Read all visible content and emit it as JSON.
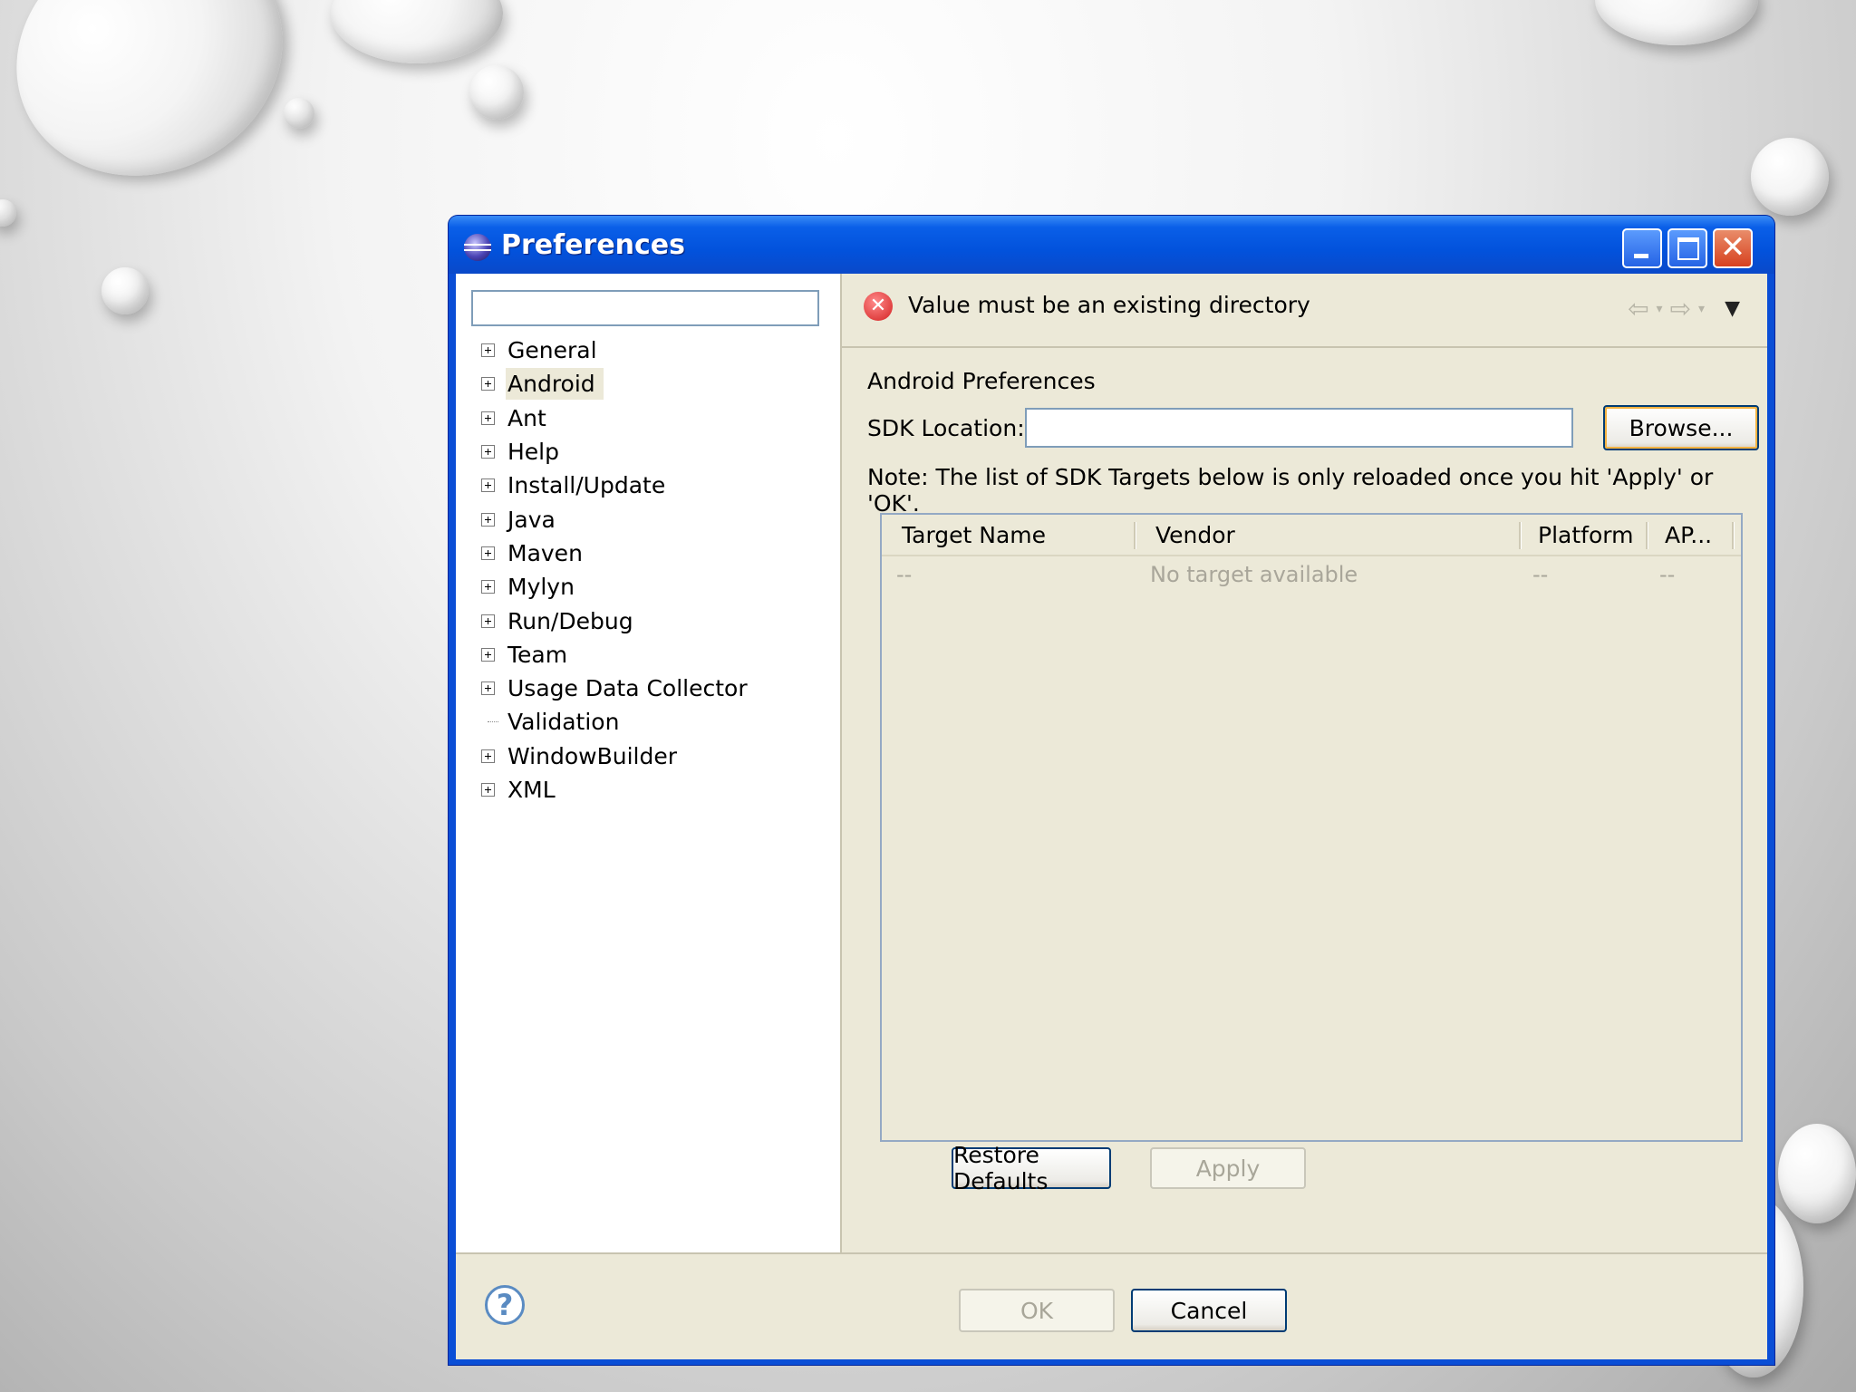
{
  "window": {
    "title": "Preferences"
  },
  "left_pane": {
    "filter_placeholder": "",
    "tree": [
      {
        "label": "General",
        "expandable": true
      },
      {
        "label": "Android",
        "expandable": true,
        "selected": true
      },
      {
        "label": "Ant",
        "expandable": true
      },
      {
        "label": "Help",
        "expandable": true
      },
      {
        "label": "Install/Update",
        "expandable": true
      },
      {
        "label": "Java",
        "expandable": true
      },
      {
        "label": "Maven",
        "expandable": true
      },
      {
        "label": "Mylyn",
        "expandable": true
      },
      {
        "label": "Run/Debug",
        "expandable": true
      },
      {
        "label": "Team",
        "expandable": true
      },
      {
        "label": "Usage Data Collector",
        "expandable": true
      },
      {
        "label": "Validation",
        "expandable": false
      },
      {
        "label": "WindowBuilder",
        "expandable": true
      },
      {
        "label": "XML",
        "expandable": true
      }
    ]
  },
  "message_bar": {
    "text": "Value must be an existing directory",
    "icon": "error-icon"
  },
  "android": {
    "section_title": "Android Preferences",
    "sdk_label": "SDK Location:",
    "sdk_value": "",
    "browse_label": "Browse...",
    "note": "Note: The list of SDK Targets below is only reloaded once you hit 'Apply' or 'OK'.",
    "table": {
      "columns": [
        "Target Name",
        "Vendor",
        "Platform",
        "AP..."
      ],
      "row": [
        "--",
        "No target available",
        "--",
        "--"
      ]
    },
    "restore_label": "Restore Defaults",
    "apply_label": "Apply"
  },
  "footer": {
    "ok_label": "OK",
    "cancel_label": "Cancel"
  },
  "colors": {
    "titlebar": "#0a5fe8",
    "dialog_bg": "#ece9d8",
    "error": "#d32121"
  }
}
